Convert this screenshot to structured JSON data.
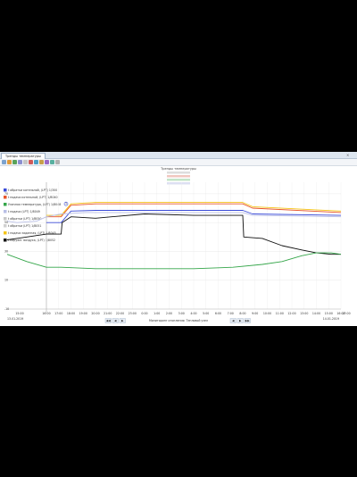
{
  "window": {
    "tab_title": "Тренды температуры",
    "tab_close": "×"
  },
  "chart_data": {
    "type": "line",
    "title": "Тренды температуры",
    "legend": [
      {
        "name": "t обратки котельной, (LPT) 1/300",
        "color": "#3a4bd8"
      },
      {
        "name": "t подачи котельной, (LPT) 1/8040",
        "color": "#e8542a"
      },
      {
        "name": "Уличная температура, (LPT) 1/8048",
        "color": "#35a64a"
      },
      {
        "name": "t подачи (LPT) 1/8049",
        "color": "#b9bfe6"
      },
      {
        "name": "t обратки (LPT) 1/8050",
        "color": "#c8c8c8"
      },
      {
        "name": "t обратки (LPT) 1/8051",
        "color": "#d0d0d0"
      },
      {
        "name": "t подачи заданная, (LPT) 1/8045",
        "color": "#f5c518"
      },
      {
        "name": "t наружн. воздуха, (LPT) 1/8052",
        "color": "#111111"
      }
    ],
    "x_ticks": [
      "16:00",
      "17:00",
      "18:00",
      "19:00",
      "20:00",
      "21:00",
      "22:00",
      "23:00",
      "0:00",
      "1:00",
      "2:00",
      "3:00",
      "4:00",
      "5:00",
      "6:00",
      "7:00",
      "8:00",
      "9:00",
      "10:00",
      "11:00",
      "12:00",
      "13:00",
      "14:00",
      "15:00",
      "16:00"
    ],
    "x_edge_labels": [
      "15:00",
      "17:00"
    ],
    "date_start": "13.01.2019",
    "date_end": "14.01.2019",
    "y_ticks": [
      "70",
      "50",
      "30",
      "10",
      "-10"
    ],
    "grid": true,
    "marker_label": "1",
    "series": [
      {
        "name": "t подачи заданная, (LPT) 1/8045",
        "color": "#f5c518",
        "values": [
          [
            0,
            55
          ],
          [
            3,
            55
          ],
          [
            5,
            63
          ],
          [
            10,
            64
          ],
          [
            40,
            64
          ],
          [
            42,
            61
          ],
          [
            60,
            58
          ]
        ]
      },
      {
        "name": "t подачи котельной, (LPT) 1/8040",
        "color": "#e8542a",
        "values": [
          [
            0,
            54
          ],
          [
            3,
            54
          ],
          [
            5,
            62
          ],
          [
            10,
            63
          ],
          [
            40,
            63
          ],
          [
            42,
            60
          ],
          [
            60,
            57
          ]
        ]
      },
      {
        "name": "t обратки котельной, (LPT) 1/300",
        "color": "#3a4bd8",
        "values": [
          [
            0,
            50
          ],
          [
            3,
            50
          ],
          [
            5,
            58
          ],
          [
            10,
            58.5
          ],
          [
            40,
            58.5
          ],
          [
            42,
            56
          ],
          [
            60,
            55
          ]
        ]
      },
      {
        "name": "t подачи (LPT) 1/8049",
        "color": "#b9bfe6",
        "values": [
          [
            -8,
            51
          ],
          [
            -6,
            50
          ],
          [
            -2,
            51
          ],
          [
            0,
            54
          ],
          [
            3,
            56
          ],
          [
            8,
            57
          ],
          [
            40,
            57
          ],
          [
            42,
            55
          ],
          [
            60,
            54
          ]
        ]
      },
      {
        "name": "t наружн. воздуха, (LPT) 1/8052",
        "color": "#111111",
        "values": [
          [
            -8,
            38
          ],
          [
            -6,
            39
          ],
          [
            -2,
            41
          ],
          [
            0,
            42
          ],
          [
            3,
            42
          ],
          [
            3.2,
            50
          ],
          [
            5,
            54
          ],
          [
            10,
            53
          ],
          [
            20,
            56
          ],
          [
            30,
            55
          ],
          [
            40,
            55
          ],
          [
            40.2,
            40
          ],
          [
            44,
            39
          ],
          [
            48,
            34
          ],
          [
            52,
            31
          ],
          [
            55,
            29
          ],
          [
            58,
            28
          ],
          [
            60,
            28
          ]
        ]
      },
      {
        "name": "Уличная температура, (LPT) 1/8048",
        "color": "#35a64a",
        "values": [
          [
            -8,
            28
          ],
          [
            -4,
            23
          ],
          [
            0,
            19
          ],
          [
            3,
            19
          ],
          [
            10,
            18
          ],
          [
            20,
            18
          ],
          [
            30,
            18
          ],
          [
            38,
            19
          ],
          [
            44,
            21
          ],
          [
            48,
            23
          ],
          [
            52,
            27
          ],
          [
            55,
            29
          ],
          [
            58,
            29
          ],
          [
            60,
            28
          ]
        ]
      }
    ],
    "nav": {
      "left_buttons": [
        "◀◀",
        "◀",
        "▶"
      ],
      "right_buttons": [
        "◀",
        "▶",
        "▶▶"
      ],
      "status": "Мониторинг отопления: Тепловой узел"
    }
  }
}
